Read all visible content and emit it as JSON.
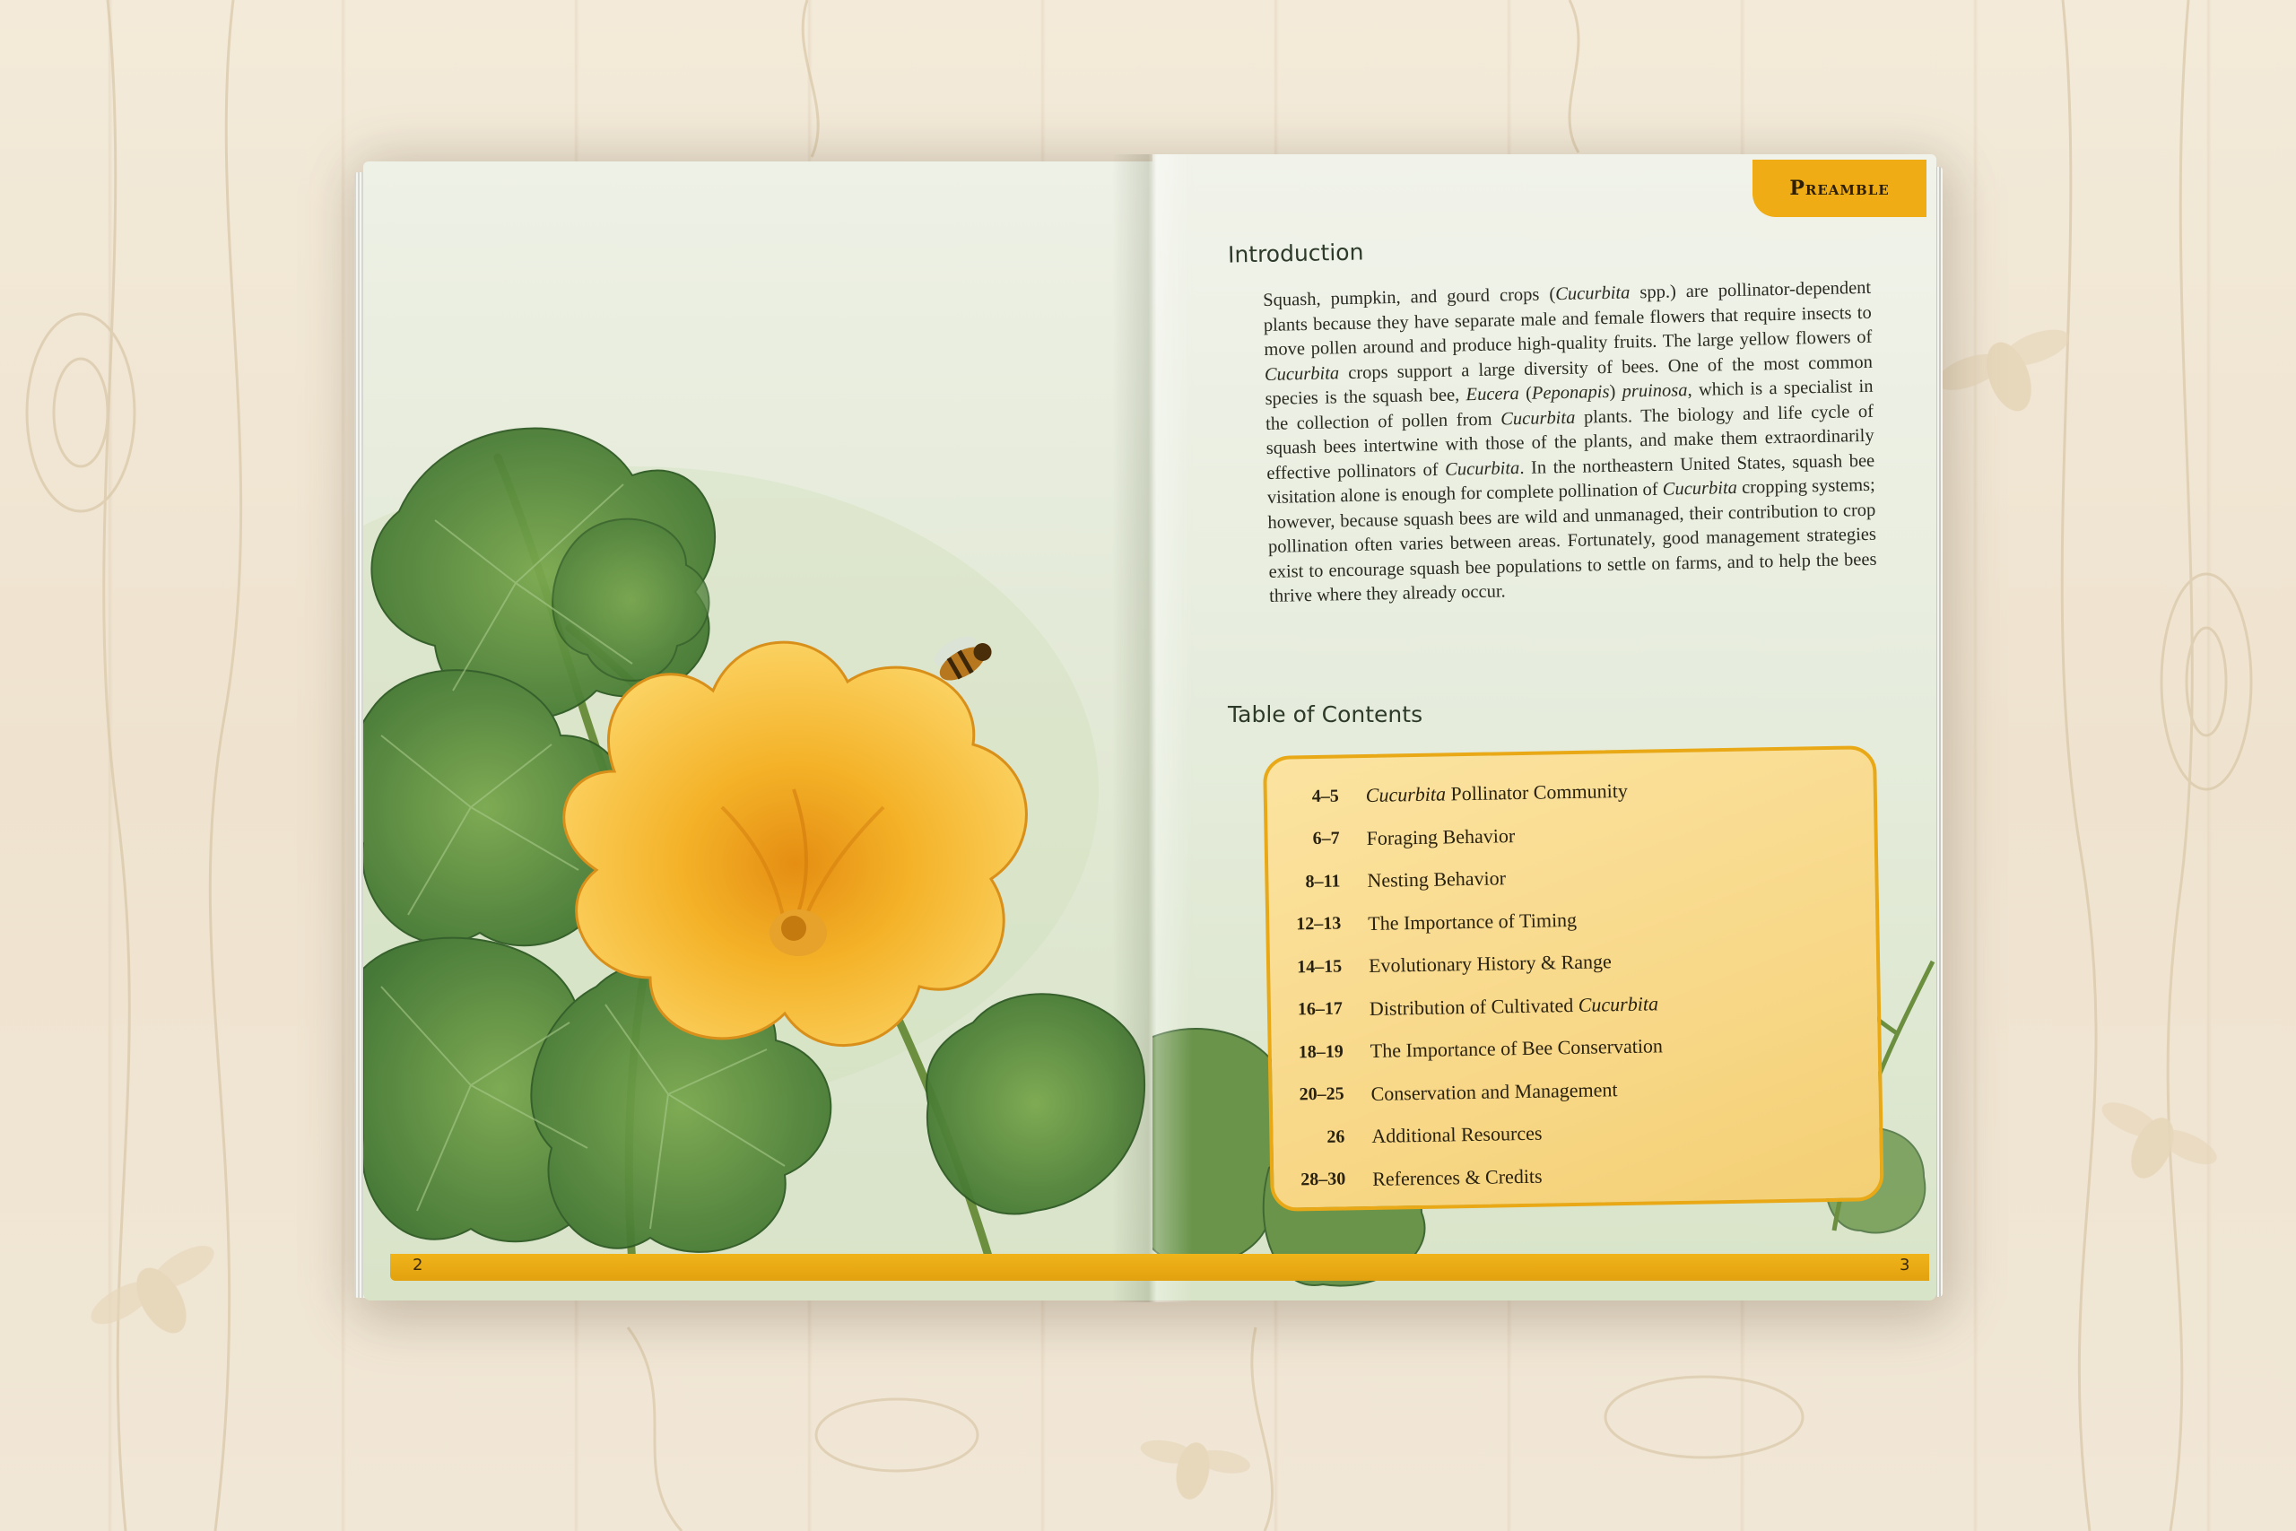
{
  "book": {
    "tab_label": "Preamble",
    "left_page_number": "2",
    "right_page_number": "3"
  },
  "introduction": {
    "heading": "Introduction",
    "paragraph_parts": [
      {
        "text": "Squash, pumpkin, and gourd crops (",
        "italic": false
      },
      {
        "text": "Cucurbita",
        "italic": true
      },
      {
        "text": " spp.) are pollinator-dependent plants because they have separate male and female flowers that require insects to move pollen around and produce high-quality fruits. The large yellow flowers of ",
        "italic": false
      },
      {
        "text": "Cucurbita",
        "italic": true
      },
      {
        "text": " crops support a large diversity of bees. One of the most common species is the squash bee, ",
        "italic": false
      },
      {
        "text": "Eucera",
        "italic": true
      },
      {
        "text": " (",
        "italic": false
      },
      {
        "text": "Peponapis",
        "italic": true
      },
      {
        "text": ") ",
        "italic": false
      },
      {
        "text": "pruinosa",
        "italic": true
      },
      {
        "text": ", which is a specialist in the collection of pollen from ",
        "italic": false
      },
      {
        "text": "Cucurbita",
        "italic": true
      },
      {
        "text": " plants. The biology and life cycle of squash bees intertwine with those of the plants, and make them extraordinarily effective pollinators of ",
        "italic": false
      },
      {
        "text": "Cucurbita",
        "italic": true
      },
      {
        "text": ". In the northeastern United States, squash bee visitation alone is enough for complete pollination of ",
        "italic": false
      },
      {
        "text": "Cucurbita",
        "italic": true
      },
      {
        "text": " cropping systems; however, because squash bees are wild and unmanaged, their contribution to crop pollination often varies between areas. Fortunately, good management strategies exist to encourage squash bee populations to settle on farms, and to help the bees thrive where they already occur.",
        "italic": false
      }
    ]
  },
  "toc": {
    "heading": "Table of Contents",
    "entries": [
      {
        "pages": "4–5",
        "italic_prefix": "Cucurbita",
        "title": " Pollinator Community",
        "italic_suffix": ""
      },
      {
        "pages": "6–7",
        "italic_prefix": "",
        "title": "Foraging Behavior",
        "italic_suffix": ""
      },
      {
        "pages": "8–11",
        "italic_prefix": "",
        "title": "Nesting Behavior",
        "italic_suffix": ""
      },
      {
        "pages": "12–13",
        "italic_prefix": "",
        "title": "The Importance of Timing",
        "italic_suffix": ""
      },
      {
        "pages": "14–15",
        "italic_prefix": "",
        "title": "Evolutionary History & Range",
        "italic_suffix": ""
      },
      {
        "pages": "16–17",
        "italic_prefix": "",
        "title": "Distribution of Cultivated ",
        "italic_suffix": "Cucurbita"
      },
      {
        "pages": "18–19",
        "italic_prefix": "",
        "title": "The Importance of Bee Conservation",
        "italic_suffix": ""
      },
      {
        "pages": "20–25",
        "italic_prefix": "",
        "title": "Conservation and Management",
        "italic_suffix": ""
      },
      {
        "pages": "26",
        "italic_prefix": "",
        "title": "Additional Resources",
        "italic_suffix": ""
      },
      {
        "pages": "28–30",
        "italic_prefix": "",
        "title": "References & Credits",
        "italic_suffix": ""
      }
    ]
  },
  "colors": {
    "accent_gold": "#efac14",
    "leaf_green": "#5e8d3a",
    "flower_yellow": "#f6b62a"
  }
}
